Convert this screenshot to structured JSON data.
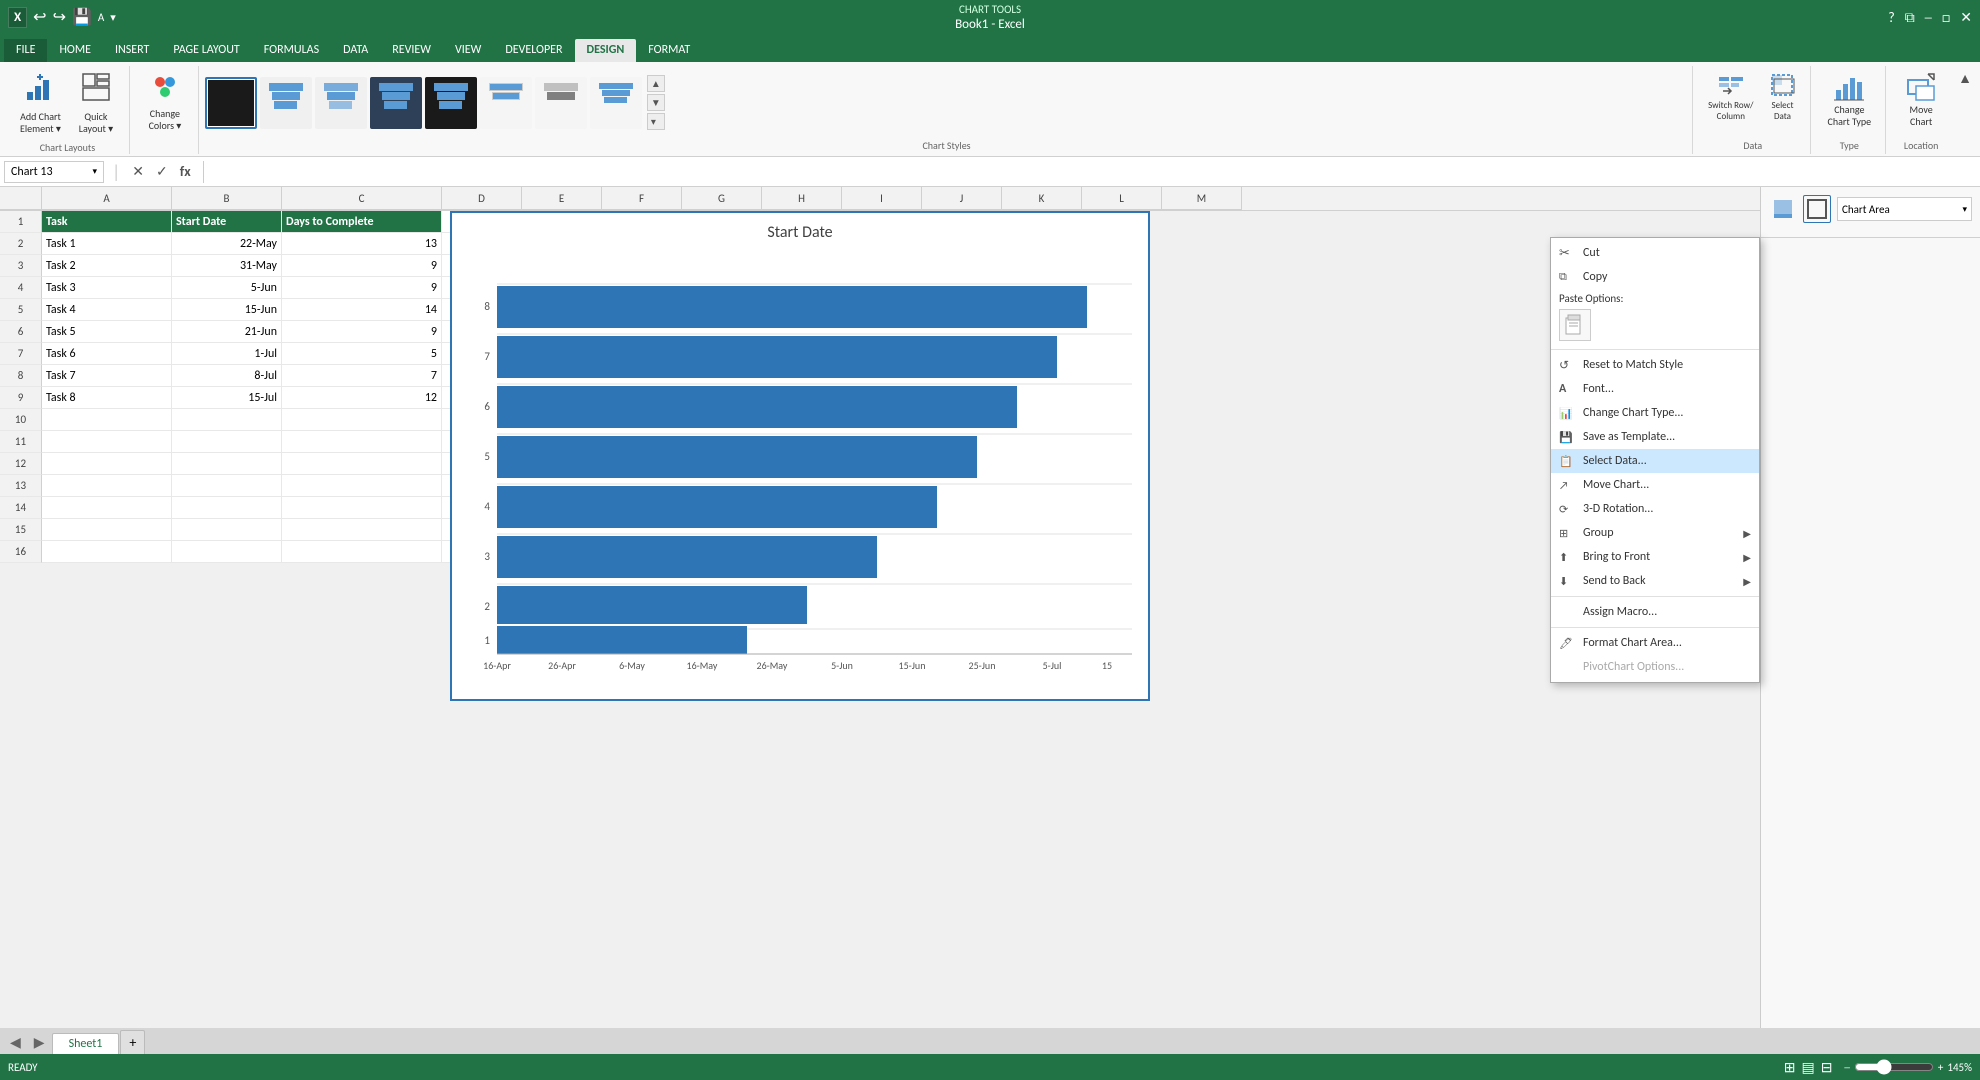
{
  "titleBar": {
    "appName": "Book1 - Excel",
    "chartTools": "CHART TOOLS"
  },
  "tabs": {
    "items": [
      "FILE",
      "HOME",
      "INSERT",
      "PAGE LAYOUT",
      "FORMULAS",
      "DATA",
      "REVIEW",
      "VIEW",
      "DEVELOPER",
      "DESIGN",
      "FORMAT"
    ],
    "activeIndex": 9,
    "highlightedIndex": 9
  },
  "ribbon": {
    "groups": [
      {
        "name": "Chart Layouts",
        "items": [
          {
            "id": "add-chart-element",
            "label": "Add Chart\nElement",
            "icon": "📊"
          },
          {
            "id": "quick-layout",
            "label": "Quick\nLayout",
            "icon": "⊞"
          }
        ]
      },
      {
        "name": "",
        "items": [
          {
            "id": "change-colors",
            "label": "Change\nColors",
            "icon": "🎨"
          }
        ]
      },
      {
        "name": "Chart Styles",
        "isGallery": true
      },
      {
        "name": "Data",
        "items": [
          {
            "id": "switch-row-col",
            "label": "Switch Row/\nColumn",
            "icon": "⇄"
          },
          {
            "id": "select-data",
            "label": "Select\nData",
            "icon": "📋"
          }
        ]
      },
      {
        "name": "Type",
        "items": [
          {
            "id": "change-chart-type",
            "label": "Change\nChart Type",
            "icon": "📈"
          }
        ]
      },
      {
        "name": "Location",
        "items": [
          {
            "id": "move-chart",
            "label": "Move\nChart",
            "icon": "↗"
          }
        ]
      }
    ]
  },
  "formulaBar": {
    "nameBox": "Chart 13",
    "formula": ""
  },
  "columns": {
    "headers": [
      "",
      "A",
      "B",
      "C",
      "D",
      "E",
      "F",
      "G",
      "H",
      "I",
      "J",
      "K",
      "L"
    ]
  },
  "spreadsheet": {
    "rows": [
      {
        "row": 1,
        "cells": [
          {
            "col": "A",
            "value": "Task",
            "isHeader": true
          },
          {
            "col": "B",
            "value": "Start Date",
            "isHeader": true
          },
          {
            "col": "C",
            "value": "Days to Complete",
            "isHeader": true
          }
        ]
      },
      {
        "row": 2,
        "cells": [
          {
            "col": "A",
            "value": "Task 1"
          },
          {
            "col": "B",
            "value": "22-May",
            "align": "right"
          },
          {
            "col": "C",
            "value": "13",
            "align": "right"
          }
        ]
      },
      {
        "row": 3,
        "cells": [
          {
            "col": "A",
            "value": "Task 2"
          },
          {
            "col": "B",
            "value": "31-May",
            "align": "right"
          },
          {
            "col": "C",
            "value": "9",
            "align": "right"
          }
        ]
      },
      {
        "row": 4,
        "cells": [
          {
            "col": "A",
            "value": "Task 3"
          },
          {
            "col": "B",
            "value": "5-Jun",
            "align": "right"
          },
          {
            "col": "C",
            "value": "9",
            "align": "right"
          }
        ]
      },
      {
        "row": 5,
        "cells": [
          {
            "col": "A",
            "value": "Task 4"
          },
          {
            "col": "B",
            "value": "15-Jun",
            "align": "right"
          },
          {
            "col": "C",
            "value": "14",
            "align": "right"
          }
        ]
      },
      {
        "row": 6,
        "cells": [
          {
            "col": "A",
            "value": "Task 5"
          },
          {
            "col": "B",
            "value": "21-Jun",
            "align": "right"
          },
          {
            "col": "C",
            "value": "9",
            "align": "right"
          }
        ]
      },
      {
        "row": 7,
        "cells": [
          {
            "col": "A",
            "value": "Task 6"
          },
          {
            "col": "B",
            "value": "1-Jul",
            "align": "right"
          },
          {
            "col": "C",
            "value": "5",
            "align": "right"
          }
        ]
      },
      {
        "row": 8,
        "cells": [
          {
            "col": "A",
            "value": "Task 7"
          },
          {
            "col": "B",
            "value": "8-Jul",
            "align": "right"
          },
          {
            "col": "C",
            "value": "7",
            "align": "right"
          }
        ]
      },
      {
        "row": 9,
        "cells": [
          {
            "col": "A",
            "value": "Task 8"
          },
          {
            "col": "B",
            "value": "15-Jul",
            "align": "right"
          },
          {
            "col": "C",
            "value": "12",
            "align": "right"
          }
        ]
      },
      {
        "row": 10,
        "cells": []
      },
      {
        "row": 11,
        "cells": []
      },
      {
        "row": 12,
        "cells": []
      },
      {
        "row": 13,
        "cells": []
      },
      {
        "row": 14,
        "cells": []
      },
      {
        "row": 15,
        "cells": []
      },
      {
        "row": 16,
        "cells": []
      }
    ]
  },
  "chart": {
    "title": "Start Date",
    "xAxisLabels": [
      "16-Apr",
      "26-Apr",
      "6-May",
      "16-May",
      "26-May",
      "5-Jun",
      "15-Jun",
      "25-Jun",
      "5-Jul",
      "15"
    ],
    "yAxisLabels": [
      "1",
      "2",
      "3",
      "4",
      "5",
      "6",
      "7",
      "8"
    ],
    "bars": [
      {
        "label": "8",
        "offsetPct": 36,
        "widthPct": 60
      },
      {
        "label": "7",
        "offsetPct": 34,
        "widthPct": 56
      },
      {
        "label": "6",
        "offsetPct": 30,
        "widthPct": 52
      },
      {
        "label": "5",
        "offsetPct": 27,
        "widthPct": 48
      },
      {
        "label": "4",
        "offsetPct": 24,
        "widthPct": 44
      },
      {
        "label": "3",
        "offsetPct": 20,
        "widthPct": 38
      },
      {
        "label": "2",
        "offsetPct": 14,
        "widthPct": 32
      },
      {
        "label": "1",
        "offsetPct": 8,
        "widthPct": 26
      }
    ],
    "barColor": "#2e75b6"
  },
  "formatPanel": {
    "title": "Chart Area",
    "icons": [
      "fill-icon",
      "outline-icon"
    ]
  },
  "contextMenu": {
    "items": [
      {
        "id": "cut",
        "label": "Cut",
        "icon": "✂",
        "hasIcon": true
      },
      {
        "id": "copy",
        "label": "Copy",
        "icon": "⧉",
        "hasIcon": true
      },
      {
        "id": "paste-options",
        "label": "Paste Options:",
        "isSection": true
      },
      {
        "id": "paste-icon",
        "label": "",
        "isPasteIcon": true
      },
      {
        "id": "sep1",
        "isSeparator": true
      },
      {
        "id": "reset-style",
        "label": "Reset to Match Style",
        "hasIcon": true,
        "icon": "↺"
      },
      {
        "id": "font",
        "label": "Font...",
        "hasIcon": false,
        "icon": "A"
      },
      {
        "id": "change-chart-type",
        "label": "Change Chart Type...",
        "hasIcon": true,
        "icon": "📈"
      },
      {
        "id": "save-template",
        "label": "Save as Template...",
        "hasIcon": true,
        "icon": "💾"
      },
      {
        "id": "select-data",
        "label": "Select Data...",
        "hasIcon": true,
        "icon": "📋",
        "highlighted": true
      },
      {
        "id": "move-chart",
        "label": "Move Chart...",
        "hasIcon": true,
        "icon": "↗"
      },
      {
        "id": "3d-rotation",
        "label": "3-D Rotation...",
        "hasIcon": true,
        "icon": "⟳"
      },
      {
        "id": "group",
        "label": "Group",
        "hasSubmenu": true,
        "icon": "⊞"
      },
      {
        "id": "bring-to-front",
        "label": "Bring to Front",
        "hasSubmenu": true,
        "icon": "⬆",
        "disabled": false
      },
      {
        "id": "send-to-back",
        "label": "Send to Back",
        "hasSubmenu": true,
        "icon": "⬇"
      },
      {
        "id": "assign-macro",
        "label": "Assign Macro...",
        "hasIcon": false
      },
      {
        "id": "format-chart-area",
        "label": "Format Chart Area...",
        "hasIcon": true,
        "icon": "🖊"
      },
      {
        "id": "pivotchart-options",
        "label": "PivotChart Options...",
        "hasIcon": false,
        "disabled": true
      }
    ]
  },
  "sheetTabs": {
    "tabs": [
      "Sheet1"
    ],
    "activeTab": "Sheet1"
  },
  "statusBar": {
    "status": "READY",
    "zoom": "145%"
  }
}
